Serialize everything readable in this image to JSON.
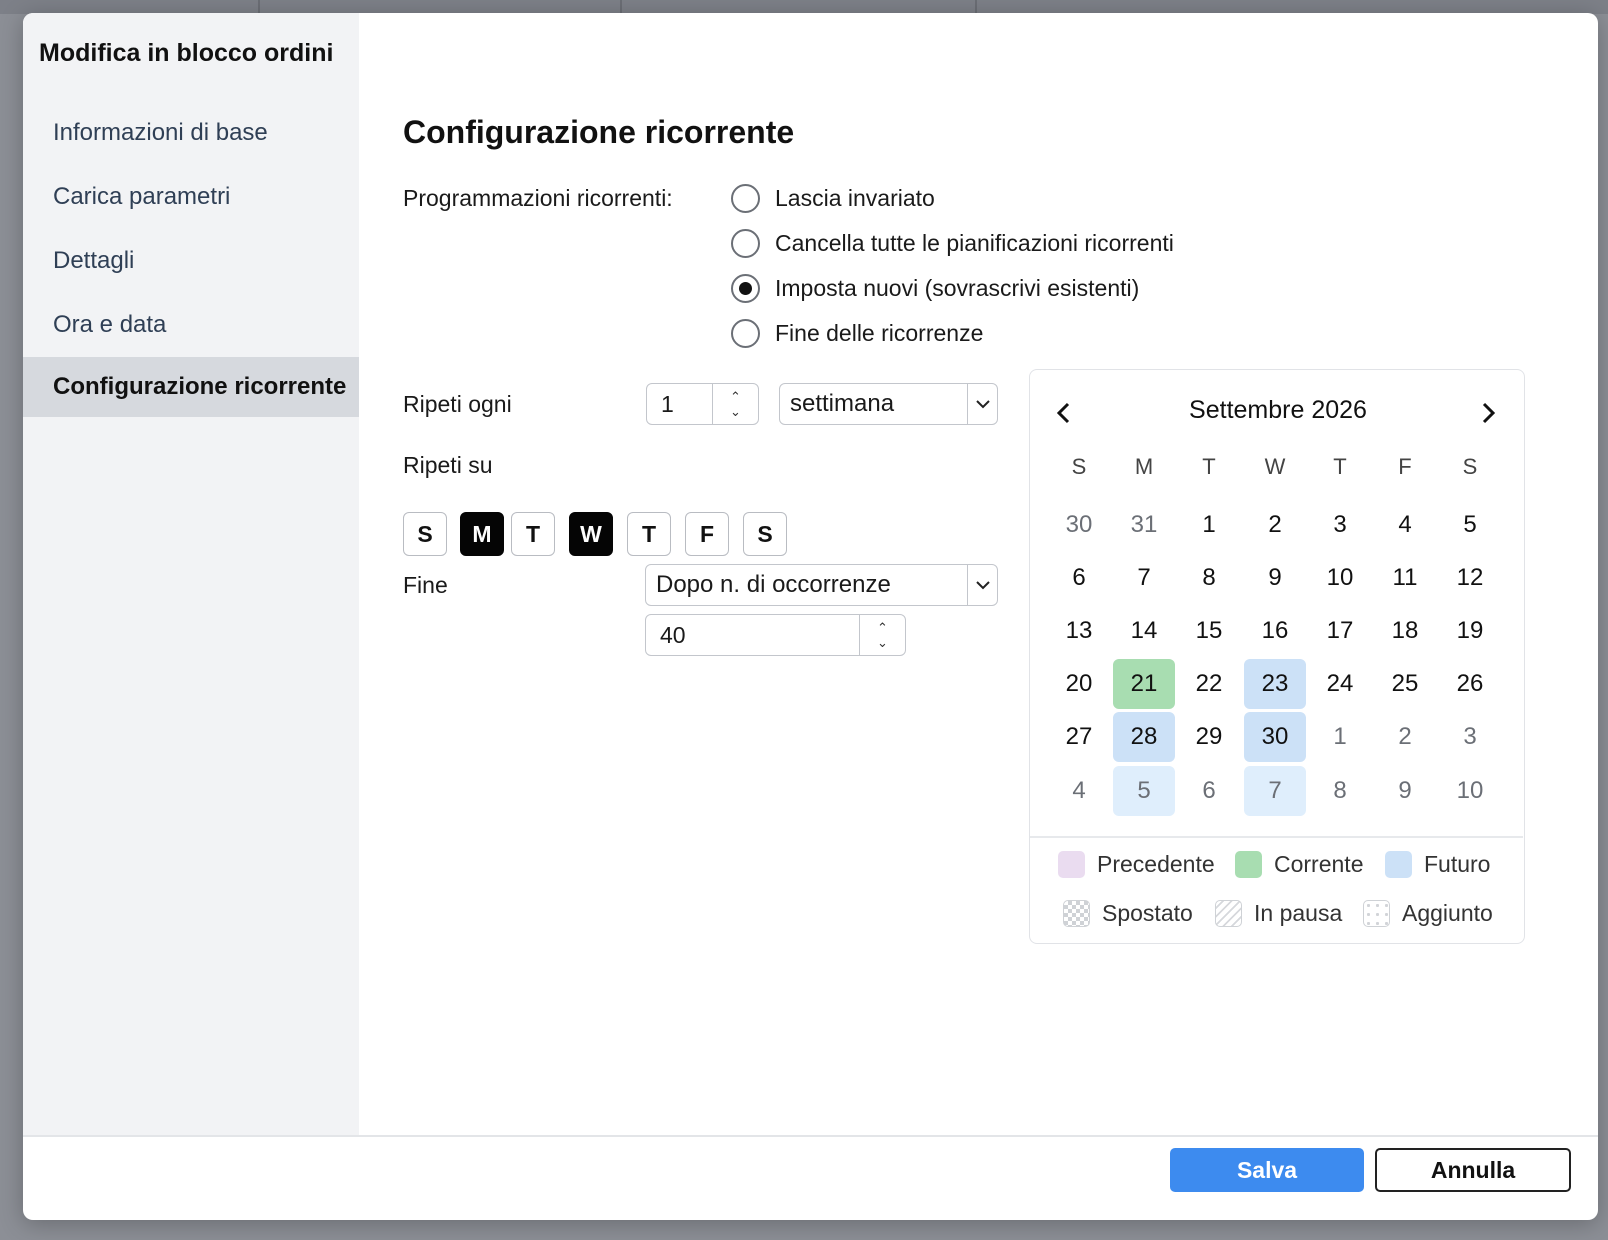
{
  "dialog": {
    "title": "Modifica in blocco ordini"
  },
  "sidebar": {
    "items": [
      {
        "label": "Informazioni di base",
        "active": false
      },
      {
        "label": "Carica parametri",
        "active": false
      },
      {
        "label": "Dettagli",
        "active": false
      },
      {
        "label": "Ora e data",
        "active": false
      },
      {
        "label": "Configurazione ricorrente",
        "active": true
      }
    ]
  },
  "section": {
    "title": "Configurazione ricorrente",
    "recurring_label": "Programmazioni ricorrenti:",
    "radio_options": [
      {
        "label": "Lascia invariato",
        "checked": false
      },
      {
        "label": "Cancella tutte le pianificazioni ricorrenti",
        "checked": false
      },
      {
        "label": "Imposta nuovi (sovrascrivi esistenti)",
        "checked": true
      },
      {
        "label": "Fine delle ricorrenze",
        "checked": false
      }
    ],
    "repeat_every_label": "Ripeti ogni",
    "repeat_every_value": "1",
    "repeat_unit": "settimana",
    "repeat_on_label": "Ripeti su",
    "weekdays": [
      {
        "label": "S",
        "selected": false
      },
      {
        "label": "M",
        "selected": true
      },
      {
        "label": "T",
        "selected": false
      },
      {
        "label": "W",
        "selected": true
      },
      {
        "label": "T",
        "selected": false
      },
      {
        "label": "F",
        "selected": false
      },
      {
        "label": "S",
        "selected": false
      }
    ],
    "end_label": "Fine",
    "end_mode": "Dopo n. di occorrenze",
    "occurrences_value": "40"
  },
  "calendar": {
    "month_title": "Settembre 2026",
    "weekday_headers": [
      "S",
      "M",
      "T",
      "W",
      "T",
      "F",
      "S"
    ],
    "weeks": [
      [
        {
          "d": "30",
          "s": "other"
        },
        {
          "d": "31",
          "s": "other"
        },
        {
          "d": "1"
        },
        {
          "d": "2"
        },
        {
          "d": "3"
        },
        {
          "d": "4"
        },
        {
          "d": "5"
        }
      ],
      [
        {
          "d": "6"
        },
        {
          "d": "7"
        },
        {
          "d": "8"
        },
        {
          "d": "9"
        },
        {
          "d": "10"
        },
        {
          "d": "11"
        },
        {
          "d": "12"
        }
      ],
      [
        {
          "d": "13"
        },
        {
          "d": "14"
        },
        {
          "d": "15"
        },
        {
          "d": "16"
        },
        {
          "d": "17"
        },
        {
          "d": "18"
        },
        {
          "d": "19"
        }
      ],
      [
        {
          "d": "20"
        },
        {
          "d": "21",
          "s": "current"
        },
        {
          "d": "22"
        },
        {
          "d": "23",
          "s": "future"
        },
        {
          "d": "24"
        },
        {
          "d": "25"
        },
        {
          "d": "26"
        }
      ],
      [
        {
          "d": "27"
        },
        {
          "d": "28",
          "s": "future"
        },
        {
          "d": "29"
        },
        {
          "d": "30",
          "s": "future"
        },
        {
          "d": "1",
          "s": "other"
        },
        {
          "d": "2",
          "s": "other"
        },
        {
          "d": "3",
          "s": "other"
        }
      ],
      [
        {
          "d": "4",
          "s": "other"
        },
        {
          "d": "5",
          "s": "other future-light"
        },
        {
          "d": "6",
          "s": "other"
        },
        {
          "d": "7",
          "s": "other future-light"
        },
        {
          "d": "8",
          "s": "other"
        },
        {
          "d": "9",
          "s": "other"
        },
        {
          "d": "10",
          "s": "other"
        }
      ]
    ],
    "legend": [
      {
        "label": "Precedente",
        "pattern": "solid",
        "color": "#eadcf0"
      },
      {
        "label": "Corrente",
        "pattern": "solid",
        "color": "#a8ddb1"
      },
      {
        "label": "Futuro",
        "pattern": "solid",
        "color": "#cce1f7"
      },
      {
        "label": "Spostato",
        "pattern": "checker",
        "color": "#cfd2d6"
      },
      {
        "label": "In pausa",
        "pattern": "stripes",
        "color": "#d6d8dc"
      },
      {
        "label": "Aggiunto",
        "pattern": "dots",
        "color": "#d2d4d8"
      }
    ]
  },
  "footer": {
    "save_label": "Salva",
    "cancel_label": "Annulla"
  },
  "colors": {
    "primary": "#3d8bef",
    "sidebar_bg": "#f2f3f5",
    "sidebar_active": "#d6d9de",
    "current_day": "#a8ddb1",
    "future_day": "#cce1f7"
  }
}
